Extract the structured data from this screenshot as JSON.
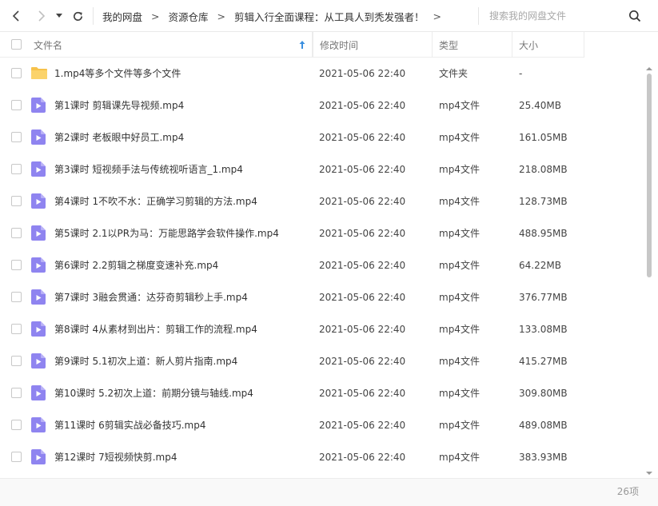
{
  "toolbar": {
    "back_icon": "chevron-left-icon",
    "forward_icon": "chevron-right-icon",
    "history_icon": "caret-down-icon",
    "refresh_icon": "refresh-icon"
  },
  "breadcrumb": {
    "items": [
      "我的网盘",
      "资源仓库",
      "剪辑入行全面课程：从工具人到秃发强者！"
    ],
    "separator": ">"
  },
  "search": {
    "placeholder": "搜索我的网盘文件",
    "value": "",
    "icon": "search-icon"
  },
  "columns": {
    "name": "文件名",
    "date": "修改时间",
    "type": "类型",
    "size": "大小",
    "sort_icon": "sort-up-arrow-icon",
    "sort_color": "#3b8fe0"
  },
  "colors": {
    "folder": "#f7c24a",
    "video": "#8f84f0"
  },
  "files": [
    {
      "icon": "folder-icon",
      "name": "1.mp4等多个文件等多个文件",
      "date": "2021-05-06 22:40",
      "type": "文件夹",
      "size": "-"
    },
    {
      "icon": "video-file-icon",
      "name": "第1课时 剪辑课先导视频.mp4",
      "date": "2021-05-06 22:40",
      "type": "mp4文件",
      "size": "25.40MB"
    },
    {
      "icon": "video-file-icon",
      "name": "第2课时 老板眼中好员工.mp4",
      "date": "2021-05-06 22:40",
      "type": "mp4文件",
      "size": "161.05MB"
    },
    {
      "icon": "video-file-icon",
      "name": "第3课时 短视频手法与传统视听语言_1.mp4",
      "date": "2021-05-06 22:40",
      "type": "mp4文件",
      "size": "218.08MB"
    },
    {
      "icon": "video-file-icon",
      "name": "第4课时 1不吹不水：正确学习剪辑的方法.mp4",
      "date": "2021-05-06 22:40",
      "type": "mp4文件",
      "size": "128.73MB"
    },
    {
      "icon": "video-file-icon",
      "name": "第5课时 2.1以PR为马：万能思路学会软件操作.mp4",
      "date": "2021-05-06 22:40",
      "type": "mp4文件",
      "size": "488.95MB"
    },
    {
      "icon": "video-file-icon",
      "name": "第6课时 2.2剪辑之梯度变速补充.mp4",
      "date": "2021-05-06 22:40",
      "type": "mp4文件",
      "size": "64.22MB"
    },
    {
      "icon": "video-file-icon",
      "name": "第7课时 3融会贯通：达芬奇剪辑秒上手.mp4",
      "date": "2021-05-06 22:40",
      "type": "mp4文件",
      "size": "376.77MB"
    },
    {
      "icon": "video-file-icon",
      "name": "第8课时 4从素材到出片：剪辑工作的流程.mp4",
      "date": "2021-05-06 22:40",
      "type": "mp4文件",
      "size": "133.08MB"
    },
    {
      "icon": "video-file-icon",
      "name": "第9课时 5.1初次上道：新人剪片指南.mp4",
      "date": "2021-05-06 22:40",
      "type": "mp4文件",
      "size": "415.27MB"
    },
    {
      "icon": "video-file-icon",
      "name": "第10课时 5.2初次上道：前期分镜与轴线.mp4",
      "date": "2021-05-06 22:40",
      "type": "mp4文件",
      "size": "309.80MB"
    },
    {
      "icon": "video-file-icon",
      "name": "第11课时 6剪辑实战必备技巧.mp4",
      "date": "2021-05-06 22:40",
      "type": "mp4文件",
      "size": "489.08MB"
    },
    {
      "icon": "video-file-icon",
      "name": "第12课时 7短视频快剪.mp4",
      "date": "2021-05-06 22:40",
      "type": "mp4文件",
      "size": "383.93MB"
    }
  ],
  "footer": {
    "count": "26项"
  }
}
